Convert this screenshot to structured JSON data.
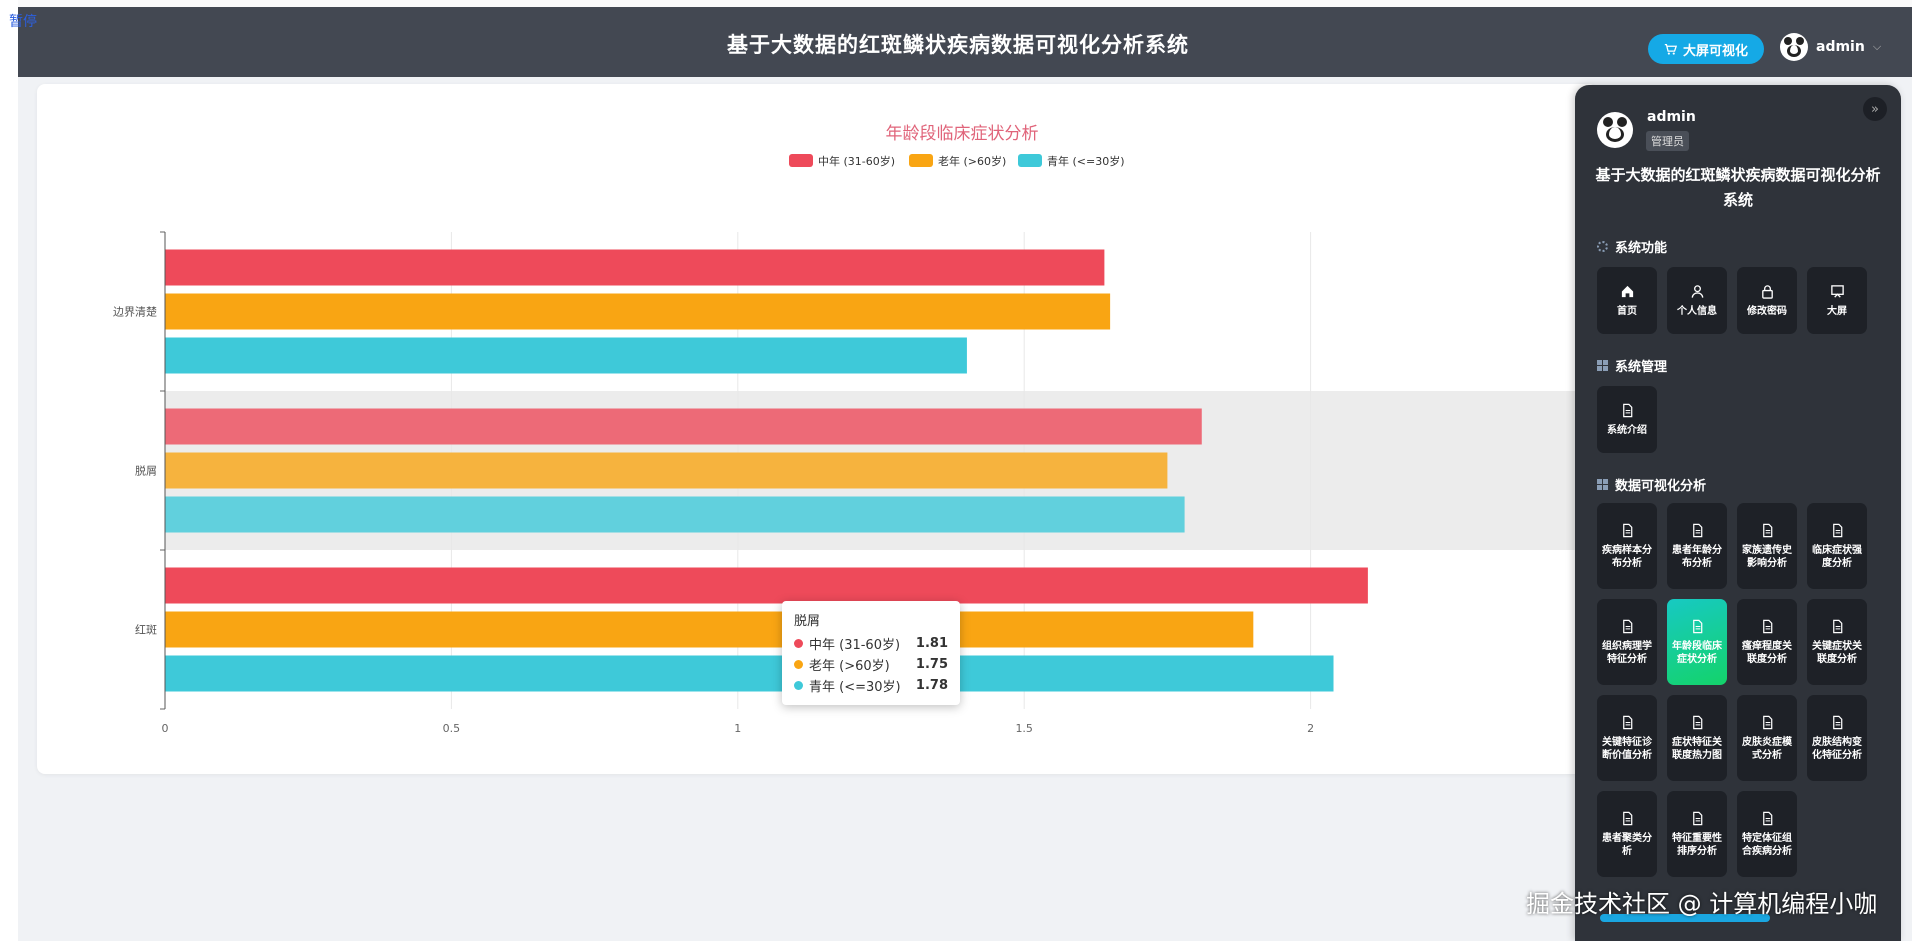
{
  "overlay": {
    "pause_label": "暂停"
  },
  "header": {
    "title": "基于大数据的红斑鳞状疾病数据可视化分析系统",
    "screen_button": "大屏可视化",
    "username": "admin"
  },
  "colors": {
    "mid": "#ee4a5a",
    "old": "#f9a513",
    "young": "#3ec9d9",
    "panel": "#2f333a"
  },
  "chart_data": {
    "type": "bar",
    "orientation": "horizontal",
    "title": "年龄段临床症状分析",
    "categories": [
      "边界清楚",
      "脱屑",
      "红斑"
    ],
    "series": [
      {
        "name": "中年 (31-60岁)",
        "values": [
          1.64,
          1.81,
          2.1
        ]
      },
      {
        "name": "老年 (>60岁)",
        "values": [
          1.65,
          1.75,
          1.9
        ]
      },
      {
        "name": "青年 (<=30岁)",
        "values": [
          1.4,
          1.78,
          2.04
        ]
      }
    ],
    "x_ticks": [
      "0",
      "0.5",
      "1",
      "1.5",
      "2"
    ],
    "xlim": [
      0,
      2.5
    ],
    "highlighted_category": "脱屑",
    "legend_position": "top-center",
    "grid": true
  },
  "tooltip": {
    "title": "脱屑",
    "rows": [
      {
        "name": "中年 (31-60岁)",
        "value": "1.81"
      },
      {
        "name": "老年 (>60岁)",
        "value": "1.75"
      },
      {
        "name": "青年 (<=30岁)",
        "value": "1.78"
      }
    ]
  },
  "panel": {
    "username": "admin",
    "role": "管理员",
    "title": "基于大数据的红斑鳞状疾病数据可视化分析系统",
    "sections": {
      "system": {
        "title": "系统功能",
        "items": [
          "首页",
          "个人信息",
          "修改密码",
          "大屏"
        ]
      },
      "manage": {
        "title": "系统管理",
        "items": [
          "系统介绍"
        ]
      },
      "analysis": {
        "title": "数据可视化分析",
        "items": [
          "疾病样本分布分析",
          "患者年龄分布分析",
          "家族遗传史影响分析",
          "临床症状强度分析",
          "组织病理学特征分析",
          "年龄段临床症状分析",
          "瘙痒程度关联度分析",
          "关键症状关联度分析",
          "关键特征诊断价值分析",
          "症状特征关联度热力图",
          "皮肤炎症模式分析",
          "皮肤结构变化特征分析",
          "患者聚类分析",
          "特征重要性排序分析",
          "特定体征组合疾病分析"
        ],
        "active": "年龄段临床症状分析"
      }
    }
  },
  "watermark": "掘金技术社区 @ 计算机编程小咖"
}
